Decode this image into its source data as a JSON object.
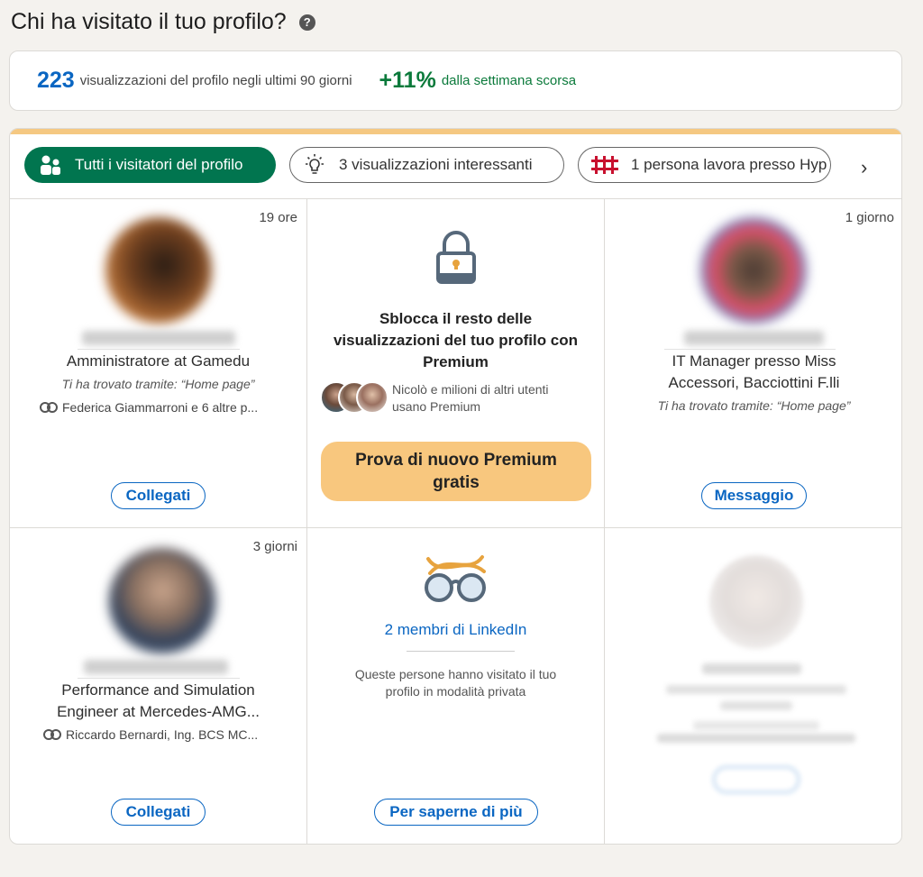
{
  "page": {
    "title": "Chi ha visitato il tuo profilo?",
    "help_icon": "?"
  },
  "stats": {
    "views_count": "223",
    "views_text": "visualizzazioni del profilo negli ultimi 90 giorni",
    "change_pct": "+11%",
    "change_text": "dalla settimana scorsa"
  },
  "filters": {
    "all": "Tutti i visitatori del profilo",
    "interesting": "3 visualizzazioni interessanti",
    "company": "1 persona lavora presso Hyp",
    "next_icon": "›"
  },
  "visitors": [
    {
      "time": "19 ore",
      "headline": "Amministratore at Gamedu",
      "via": "Ti ha trovato tramite: “Home page”",
      "mutual": "Federica Giammarroni e 6 altre p...",
      "button": "Collegati"
    },
    {
      "time": "1 giorno",
      "headline_line1": "IT Manager presso Miss",
      "headline_line2": "Accessori, Bacciottini F.lli",
      "via": "Ti ha trovato tramite: “Home page”",
      "button": "Messaggio"
    },
    {
      "time": "3 giorni",
      "headline_line1": "Performance and Simulation",
      "headline_line2": "Engineer at Mercedes-AMG...",
      "mutual": "Riccardo Bernardi, Ing. BCS MC...",
      "button": "Collegati"
    }
  ],
  "premium": {
    "title_line1": "Sblocca il resto delle",
    "title_line2": "visualizzazioni del tuo profilo con",
    "title_line3": "Premium",
    "note_line1": "Nicolò e milioni di altri utenti",
    "note_line2": "usano Premium",
    "button_line1": "Prova di nuovo Premium",
    "button_line2": "gratis"
  },
  "private": {
    "members": "2 membri di LinkedIn",
    "note_line1": "Queste persone hanno visitato il tuo",
    "note_line2": "profilo in modalità privata",
    "button": "Per saperne di più"
  },
  "colors": {
    "accent": "#0a66c2",
    "green": "#01754f",
    "premium": "#f8c77e"
  }
}
